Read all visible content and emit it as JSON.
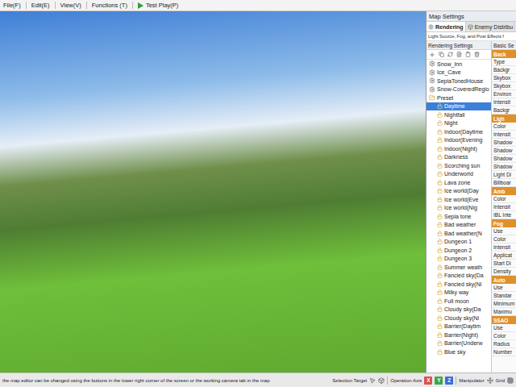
{
  "menu": {
    "items": [
      {
        "label": "File(F)"
      },
      {
        "label": "Edit(E)"
      },
      {
        "label": "View(V)"
      },
      {
        "label": "Functions (T)"
      }
    ],
    "play": {
      "label": "Test Play(P)"
    }
  },
  "panel": {
    "title": "Map Settings",
    "tabs": [
      {
        "label": "Rendering",
        "selected": true
      },
      {
        "label": "Enemy Distribu",
        "selected": false
      }
    ],
    "description": "Light Source, Fog, and Post Effects f",
    "list": {
      "title": "Rendering Settings",
      "items": [
        {
          "label": "Snow_Inn",
          "kind": "setting",
          "selected": false
        },
        {
          "label": "Ice_Cave",
          "kind": "setting",
          "selected": false
        },
        {
          "label": "SepiaTonedHouse",
          "kind": "setting",
          "selected": false
        },
        {
          "label": "Snow-CoveredRegio",
          "kind": "setting",
          "selected": false
        },
        {
          "label": "Preset",
          "kind": "folder",
          "selected": false,
          "expanded": true
        },
        {
          "label": "Daytime",
          "kind": "preset",
          "selected": true
        },
        {
          "label": "Nightfall",
          "kind": "preset",
          "selected": false
        },
        {
          "label": "Night",
          "kind": "preset",
          "selected": false
        },
        {
          "label": "Indoor(Daytime",
          "kind": "preset",
          "selected": false
        },
        {
          "label": "Indoor(Evening",
          "kind": "preset",
          "selected": false
        },
        {
          "label": "Indoor(Night)",
          "kind": "preset",
          "selected": false
        },
        {
          "label": "Darkness",
          "kind": "preset",
          "selected": false
        },
        {
          "label": "Scorching sun",
          "kind": "preset",
          "selected": false
        },
        {
          "label": "Underworld",
          "kind": "preset",
          "selected": false
        },
        {
          "label": "Lava zone",
          "kind": "preset",
          "selected": false
        },
        {
          "label": "Ice world(Day",
          "kind": "preset",
          "selected": false
        },
        {
          "label": "Ice world(Eve",
          "kind": "preset",
          "selected": false
        },
        {
          "label": "Ice world(Nig",
          "kind": "preset",
          "selected": false
        },
        {
          "label": "Sepia tone",
          "kind": "preset",
          "selected": false
        },
        {
          "label": "Bad weather",
          "kind": "preset",
          "selected": false
        },
        {
          "label": "Bad weather(N",
          "kind": "preset",
          "selected": false
        },
        {
          "label": "Dungeon 1",
          "kind": "preset",
          "selected": false
        },
        {
          "label": "Dungeon 2",
          "kind": "preset",
          "selected": false
        },
        {
          "label": "Dungeon 3",
          "kind": "preset",
          "selected": false
        },
        {
          "label": "Summer weath",
          "kind": "preset",
          "selected": false
        },
        {
          "label": "Fancied sky(Da",
          "kind": "preset",
          "selected": false
        },
        {
          "label": "Fancied sky(Ni",
          "kind": "preset",
          "selected": false
        },
        {
          "label": "Milky way",
          "kind": "preset",
          "selected": false
        },
        {
          "label": "Full moon",
          "kind": "preset",
          "selected": false
        },
        {
          "label": "Cloudy sky(Da",
          "kind": "preset",
          "selected": false
        },
        {
          "label": "Cloudy sky(Ni",
          "kind": "preset",
          "selected": false
        },
        {
          "label": "Barrier(Daytim",
          "kind": "preset",
          "selected": false
        },
        {
          "label": "Barrier(Night)",
          "kind": "preset",
          "selected": false
        },
        {
          "label": "Barrier(Underw",
          "kind": "preset",
          "selected": false
        },
        {
          "label": "Blue sky",
          "kind": "preset",
          "selected": false
        }
      ]
    },
    "properties": {
      "title": "Basic Se",
      "groups": [
        {
          "header": "Back",
          "rows": [
            "Type",
            "Backgr",
            "Skybox",
            "Skybox",
            "Environ",
            "Intensit",
            "Backgr"
          ]
        },
        {
          "header": "Ligh",
          "rows": [
            "Color",
            "Intensit",
            "Shadow",
            "Shadow",
            "Shadow",
            "Shadow",
            "Light Di",
            "Billboar"
          ]
        },
        {
          "header": "Amb",
          "rows": [
            "Color",
            "Intensit",
            "IBL Inte"
          ]
        },
        {
          "header": "Fog",
          "rows": [
            "Use",
            "Color",
            "Intensit",
            "Applicat",
            "Start Di",
            "Density"
          ]
        },
        {
          "header": "Auto",
          "rows": [
            "Use",
            "Standar",
            "Minimum",
            "Maximu"
          ]
        },
        {
          "header": "SSAO",
          "rows": [
            "Use",
            "Color",
            "Radius",
            "Number"
          ]
        }
      ]
    }
  },
  "status_bar": {
    "hint": "the map editor can be changed using the buttons in the lower right corner of the screen or the working camera tab in the map",
    "selection_label": "Selection Target",
    "axis_label": "Operation Axis",
    "axes": [
      {
        "label": "X",
        "color": "#d9534f"
      },
      {
        "label": "Y",
        "color": "#3aa64c"
      },
      {
        "label": "Z",
        "color": "#3b6fd9"
      }
    ],
    "manipulator_label": "Manipulator",
    "grid_label": "Grid"
  }
}
